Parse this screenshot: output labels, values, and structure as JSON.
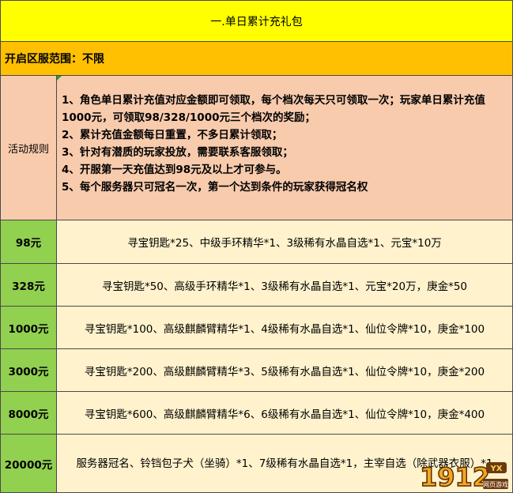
{
  "title": "一.单日累计充礼包",
  "scope": "开启区服范围：不限",
  "rules": {
    "label": "活动规则",
    "items": [
      "1、角色单日累计充值对应金额即可领取，每个档次每天只可领取一次；玩家单日累计充值1000元，可领取98/328/1000元三个档次的奖励；",
      "2、累计充值金额每日重置，不多日累计领取；",
      "3、针对有潜质的玩家投放，需要联系客服领取；",
      "4、开服第一天充值达到98元及以上才可参与。",
      "5、每个服务器只可冠名一次，第一个达到条件的玩家获得冠名权"
    ]
  },
  "tiers": [
    {
      "amount": "98元",
      "reward": "寻宝钥匙*25、中级手环精华*1、3级稀有水晶自选*1、元宝*10万"
    },
    {
      "amount": "328元",
      "reward": "寻宝钥匙*50、高级手环精华*1、3级稀有水晶自选*1、元宝*20万，庚金*50"
    },
    {
      "amount": "1000元",
      "reward": "寻宝钥匙*100、高级麒麟臂精华*1、4级稀有水晶自选*1、仙位令牌*10，庚金*100"
    },
    {
      "amount": "3000元",
      "reward": "寻宝钥匙*200、高级麒麟臂精华*3、5级稀有水晶自选*1、仙位令牌*10，庚金*200"
    },
    {
      "amount": "8000元",
      "reward": "寻宝钥匙*600、高级麒麟臂精华*6、6级稀有水晶自选*1、仙位令牌*10，庚金*400"
    },
    {
      "amount": "20000元",
      "reward": "服务器冠名、铃铛包子犬（坐骑）*1、7级稀有水晶自选*1，主宰自选（除武器衣服）*1"
    }
  ],
  "watermark": {
    "brand": "1912",
    "sub_badge": "YX",
    "caption": "网页游戏"
  },
  "colors": {
    "title_bg": "#ffff00",
    "scope_bg": "#fec000",
    "rules_bg": "#f8cbad",
    "tier_label_bg": "#92d050",
    "tier_reward_bg": "#fff2cc"
  }
}
